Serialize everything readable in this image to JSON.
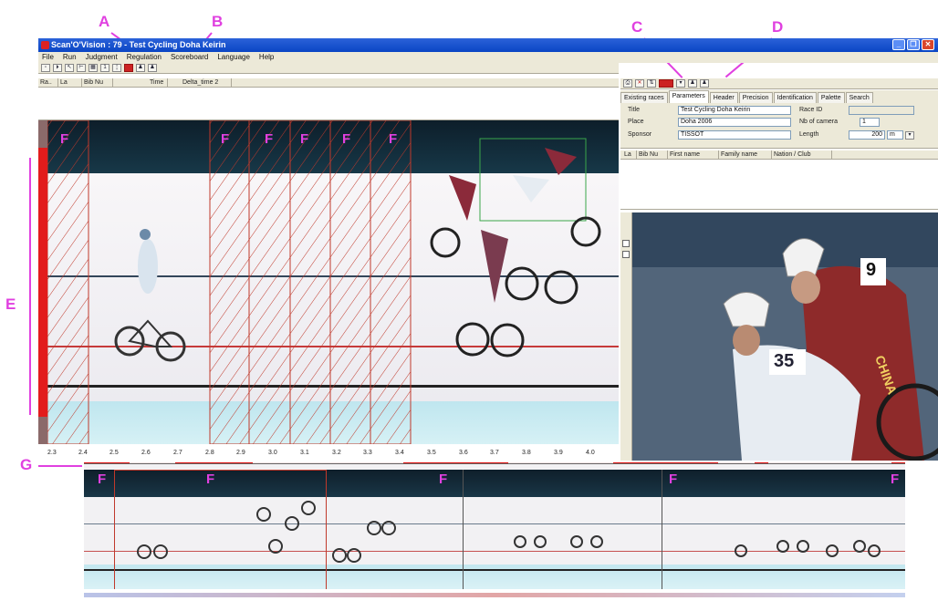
{
  "callouts": {
    "a": "A",
    "b": "B",
    "c": "C",
    "d": "D",
    "e": "E",
    "g": "G"
  },
  "window": {
    "title": "Scan'O'Vision : 79 - Test Cycling Doha Keirin"
  },
  "menu": [
    "File",
    "Run",
    "Judgment",
    "Regulation",
    "Scoreboard",
    "Language",
    "Help"
  ],
  "list_columns": [
    "Ra..",
    "La",
    "Bib Nu",
    "Time",
    "Delta_time 2"
  ],
  "tabs": [
    "Existing races",
    "Parameters",
    "Header",
    "Precision",
    "Identification",
    "Palette",
    "Search"
  ],
  "params": {
    "title_label": "Title",
    "title_value": "Test Cycling Doha Keirin",
    "race_id_label": "Race ID",
    "race_id_value": "",
    "place_label": "Place",
    "place_value": "Doha 2006",
    "nb_camera_label": "Nb of camera",
    "nb_camera_value": "1",
    "sponsor_label": "Sponsor",
    "sponsor_value": "TISSOT",
    "length_label": "Length",
    "length_value": "200",
    "length_unit": "m"
  },
  "grid_columns": [
    "La",
    "Bib Nu",
    "First name",
    "Family name",
    "Nation / Club"
  ],
  "finish_f_marks": [
    "F",
    "F",
    "F",
    "F",
    "F",
    "F"
  ],
  "axis_ticks": [
    "2.3",
    "2.4",
    "2.5",
    "2.6",
    "2.7",
    "2.8",
    "2.9",
    "3.0",
    "3.1",
    "3.2",
    "3.3",
    "3.4",
    "3.5",
    "3.6",
    "3.7",
    "3.8",
    "3.9",
    "4.0"
  ],
  "strip_f_marks": [
    "F",
    "F",
    "F",
    "F",
    "F"
  ],
  "photo": {
    "bib_back": "9",
    "bib_front": "35",
    "jersey_text": "CHINA"
  },
  "colors": {
    "accent": "#e040e0",
    "finish_red": "#e21c1c",
    "title_blue": "#0a45c4"
  }
}
